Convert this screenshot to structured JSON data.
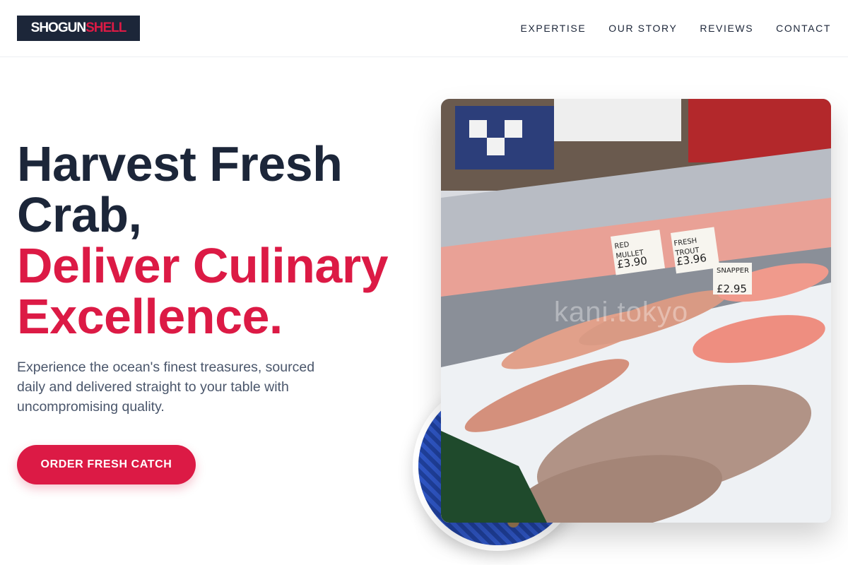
{
  "brand": {
    "name_part1": "SHOGUN",
    "name_part2": "SHELL",
    "color_dark": "#1c2639",
    "color_accent": "#dc1a45"
  },
  "nav": {
    "items": [
      {
        "label": "EXPERTISE"
      },
      {
        "label": "OUR STORY"
      },
      {
        "label": "REVIEWS"
      },
      {
        "label": "CONTACT"
      }
    ]
  },
  "hero": {
    "headline_line1": "Harvest Fresh Crab,",
    "headline_line2": "Deliver Culinary Excellence.",
    "description": "Experience the ocean's finest treasures, sourced daily and delivered straight to your table with uncompromising quality.",
    "cta_label": "ORDER FRESH CATCH"
  },
  "images": {
    "main_watermark": "kani.tokyo",
    "signs": [
      {
        "line1": "RED",
        "line2": "MULLET",
        "price": "£3.90"
      },
      {
        "line1": "FRESH",
        "line2": "TROUT",
        "price": "£3.96"
      },
      {
        "line1": "SNAPPER",
        "line2": "",
        "price": "£2.95"
      }
    ]
  }
}
